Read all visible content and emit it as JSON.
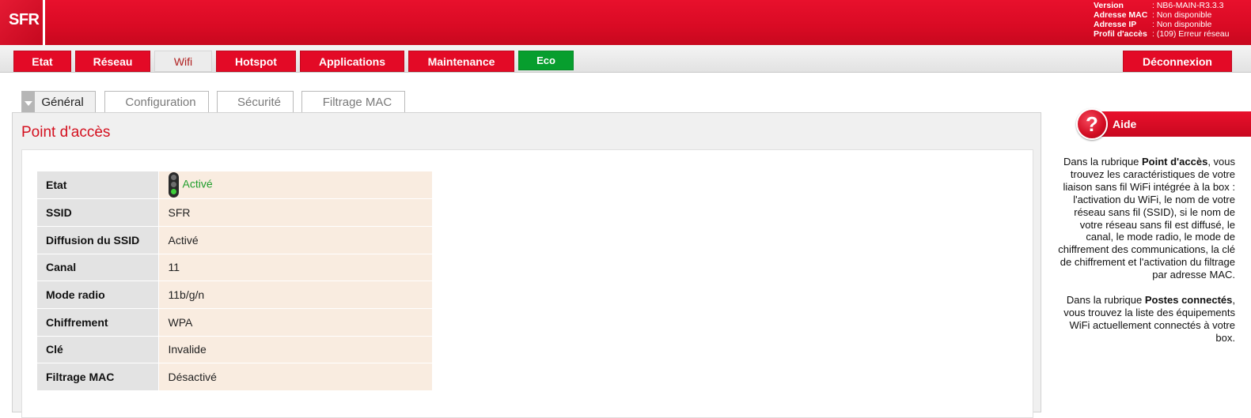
{
  "header": {
    "logo": "SFR",
    "info": [
      {
        "label": "Version",
        "value": ": NB6-MAIN-R3.3.3"
      },
      {
        "label": "Adresse MAC",
        "value": ": Non disponible"
      },
      {
        "label": "Adresse IP",
        "value": ": Non disponible"
      },
      {
        "label": "Profil d'accès",
        "value": ": (109) Erreur réseau"
      }
    ]
  },
  "nav": {
    "items": [
      "Etat",
      "Réseau",
      "Wifi",
      "Hotspot",
      "Applications",
      "Maintenance",
      "Eco"
    ],
    "active": "Wifi",
    "logout": "Déconnexion"
  },
  "subtabs": [
    "Général",
    "Configuration",
    "Sécurité",
    "Filtrage MAC"
  ],
  "panel": {
    "title": "Point d'accès",
    "rows": [
      {
        "label": "Etat",
        "value": "Activé"
      },
      {
        "label": "SSID",
        "value": "SFR"
      },
      {
        "label": "Diffusion du SSID",
        "value": "Activé"
      },
      {
        "label": "Canal",
        "value": "11"
      },
      {
        "label": "Mode radio",
        "value": "11b/g/n"
      },
      {
        "label": "Chiffrement",
        "value": "WPA"
      },
      {
        "label": "Clé",
        "value": "Invalide"
      },
      {
        "label": "Filtrage MAC",
        "value": "Désactivé"
      }
    ]
  },
  "help": {
    "title": "Aide",
    "icon": "question-icon",
    "p1_pre": "Dans la rubrique ",
    "p1_bold": "Point d'accès",
    "p1_post": ", vous trouvez les caractéristiques de votre liaison sans fil WiFi intégrée à la box : l'activation du WiFi, le nom de votre réseau sans fil (SSID), si le nom de votre réseau sans fil est diffusé, le canal, le mode radio, le mode de chiffrement des communications, la clé de chiffrement et l'activation du filtrage par adresse MAC.",
    "p2_pre": "Dans la rubrique ",
    "p2_bold": "Postes connectés",
    "p2_post": ", vous trouvez la liste des équipements WiFi actuellement connectés à votre box."
  },
  "colors": {
    "brand_red": "#e30a26",
    "eco_green": "#079e2e",
    "status_green": "#1f9d2b"
  }
}
